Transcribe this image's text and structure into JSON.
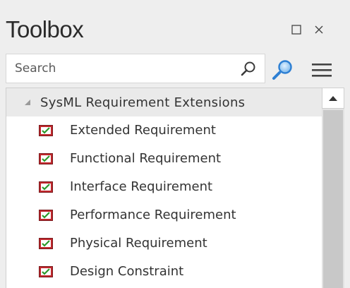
{
  "window": {
    "title": "Toolbox",
    "restore_icon": "restore-icon",
    "close_icon": "close-icon"
  },
  "search": {
    "placeholder": "Search",
    "value": "",
    "search_icon": "magnifier-icon",
    "find_icon": "find-magnifier-icon",
    "menu_icon": "hamburger-menu-icon"
  },
  "group": {
    "label": "SysML Requirement Extensions",
    "expanded": true,
    "items": [
      {
        "label": "Extended Requirement",
        "icon": "requirement-icon"
      },
      {
        "label": "Functional Requirement",
        "icon": "requirement-icon"
      },
      {
        "label": "Interface Requirement",
        "icon": "requirement-icon"
      },
      {
        "label": "Performance Requirement",
        "icon": "requirement-icon"
      },
      {
        "label": "Physical Requirement",
        "icon": "requirement-icon"
      },
      {
        "label": "Design Constraint",
        "icon": "requirement-icon"
      }
    ]
  },
  "colors": {
    "background": "#eeeeee",
    "group_header": "#eaeaea",
    "icon_red": "#c0282d",
    "icon_green": "#2a9a2a",
    "find_icon_blue": "#2d7fd3"
  }
}
